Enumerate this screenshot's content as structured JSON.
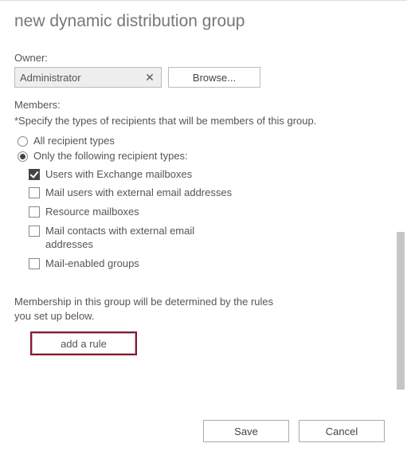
{
  "title": "new dynamic distribution group",
  "owner": {
    "label": "Owner:",
    "value": "Administrator",
    "browse": "Browse..."
  },
  "members": {
    "label": "Members:",
    "hint": "*Specify the types of recipients that will be members of this group.",
    "options": {
      "all": {
        "label": "All recipient types",
        "selected": false
      },
      "only": {
        "label": "Only the following recipient types:",
        "selected": true
      }
    },
    "types": [
      {
        "label": "Users with Exchange mailboxes",
        "checked": true
      },
      {
        "label": "Mail users with external email addresses",
        "checked": false
      },
      {
        "label": "Resource mailboxes",
        "checked": false
      },
      {
        "label": "Mail contacts with external email addresses",
        "checked": false
      },
      {
        "label": "Mail-enabled groups",
        "checked": false
      }
    ]
  },
  "membership_note": "Membership in this group will be determined by the rules you set up below.",
  "add_rule": "add a rule",
  "buttons": {
    "save": "Save",
    "cancel": "Cancel"
  }
}
